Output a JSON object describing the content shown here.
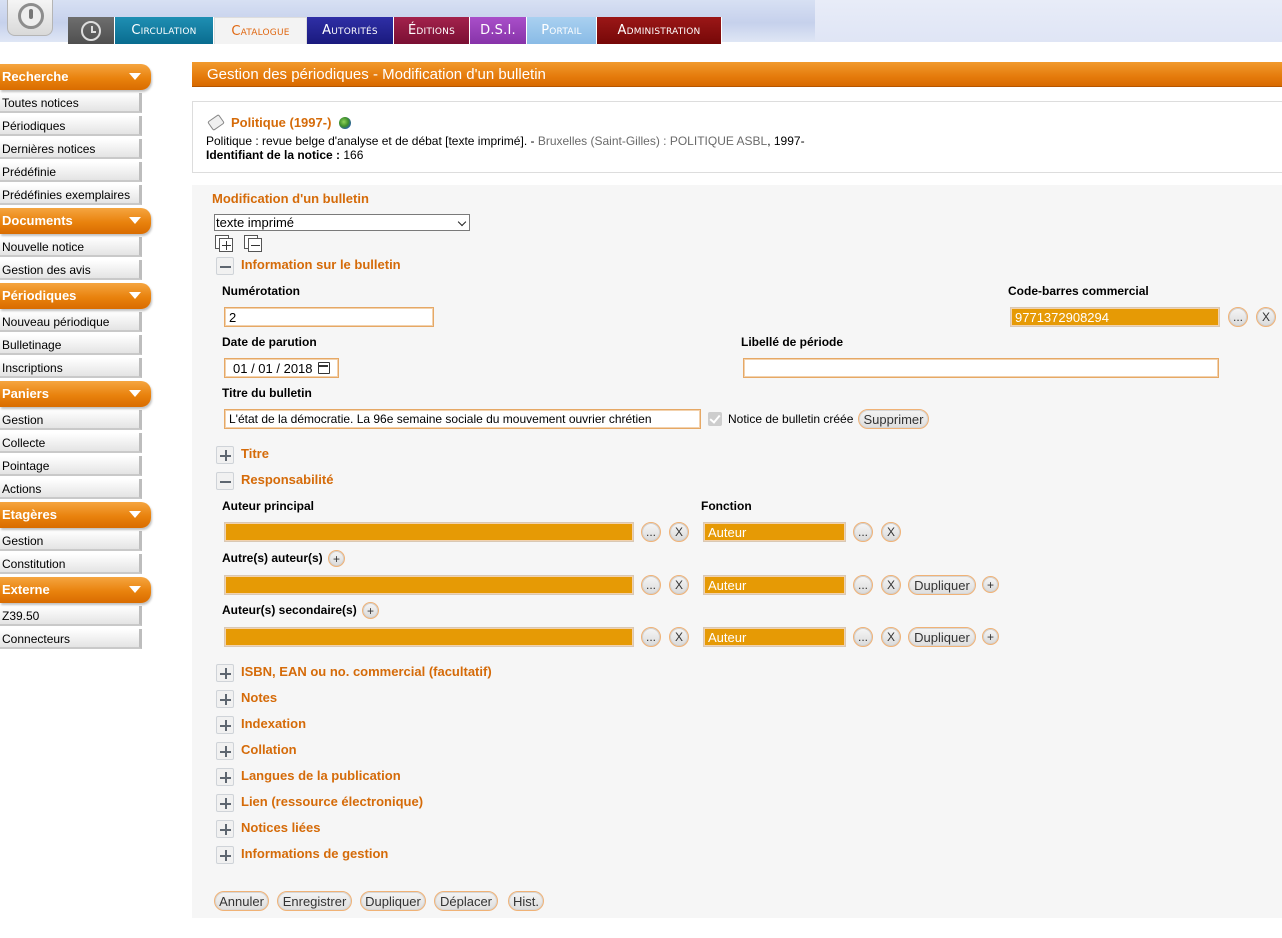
{
  "nav": {
    "tabs": [
      {
        "label": "Circulation"
      },
      {
        "label": "Catalogue"
      },
      {
        "label": "Autorités"
      },
      {
        "label": "Éditions"
      },
      {
        "label": "D.S.I."
      },
      {
        "label": "Portail"
      },
      {
        "label": "Administration"
      }
    ]
  },
  "sidebar": {
    "recherche": {
      "title": "Recherche",
      "items": [
        "Toutes notices",
        "Périodiques",
        "Dernières notices",
        "Prédéfinie",
        "Prédéfinies exemplaires"
      ]
    },
    "documents": {
      "title": "Documents",
      "items": [
        "Nouvelle notice",
        "Gestion des avis"
      ]
    },
    "periodiques": {
      "title": "Périodiques",
      "items": [
        "Nouveau périodique",
        "Bulletinage",
        "Inscriptions"
      ]
    },
    "paniers": {
      "title": "Paniers",
      "items": [
        "Gestion",
        "Collecte",
        "Pointage",
        "Actions"
      ]
    },
    "etageres": {
      "title": "Etagères",
      "items": [
        "Gestion",
        "Constitution"
      ]
    },
    "externe": {
      "title": "Externe",
      "items": [
        "Z39.50",
        "Connecteurs"
      ]
    }
  },
  "page": {
    "title": "Gestion des périodiques - Modification d'un bulletin"
  },
  "notice": {
    "title": "Politique (1997-)",
    "description_start": "Politique : revue belge d'analyse et de débat [texte imprimé]. - ",
    "publisher": "Bruxelles (Saint-Gilles) : POLITIQUE ASBL",
    "description_end": ", 1997-",
    "id_label": "Identifiant de la notice :",
    "id_value": " 166"
  },
  "form": {
    "title": "Modification d'un bulletin",
    "doc_type": "texte imprimé",
    "section_info": "Information sur le bulletin",
    "numerotation_label": "Numérotation",
    "numerotation_value": "2",
    "barcode_label": "Code-barres commercial",
    "barcode_value": "9771372908294",
    "date_label": "Date de parution",
    "date_value": "01 / 01 / 2018",
    "periode_label": "Libellé de période",
    "periode_value": "",
    "titre_bulletin_label": "Titre du bulletin",
    "titre_bulletin_value": "L'état de la démocratie. La 96e semaine sociale du mouvement ouvrier chrétien",
    "notice_creee_label": "Notice de bulletin créée",
    "supprimer": "Supprimer",
    "section_titre": "Titre",
    "section_resp": "Responsabilité",
    "auteur_principal_label": "Auteur principal",
    "fonction_label": "Fonction",
    "autres_auteurs_label": "Autre(s) auteur(s)",
    "auteurs_secondaires_label": "Auteur(s) secondaire(s)",
    "fonction_value": "Auteur",
    "dots": "...",
    "x": "X",
    "plus": "+",
    "dupliquer": "Dupliquer",
    "sections": [
      "ISBN, EAN ou no. commercial (facultatif)",
      "Notes",
      "Indexation",
      "Collation",
      "Langues de la publication",
      "Lien (ressource électronique)",
      "Notices liées",
      "Informations de gestion"
    ]
  },
  "actions": {
    "annuler": "Annuler",
    "enregistrer": "Enregistrer",
    "dupliquer": "Dupliquer",
    "deplacer": "Déplacer",
    "hist": "Hist."
  }
}
